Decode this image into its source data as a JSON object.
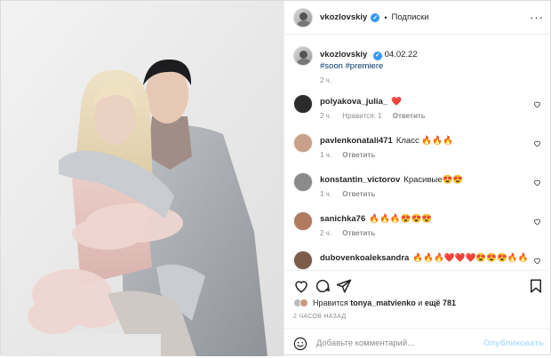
{
  "post": {
    "author": "vkozlovskiy",
    "verified": true,
    "follow_label": "Подписки",
    "dot": "•",
    "more_label": "···"
  },
  "caption": {
    "author": "vkozlovskiy",
    "date": "04.02.22",
    "hashtags": "#soon #premiere",
    "time": "2 ч."
  },
  "comments": [
    {
      "user": "polyakova_julia_",
      "text": "❤️",
      "time": "2 ч.",
      "likes": "Нравится: 1",
      "reply": "Ответить",
      "avatar_color": "#2b2b2b"
    },
    {
      "user": "pavlenkonatali471",
      "text": "Класс 🔥🔥🔥",
      "time": "1 ч.",
      "likes": "",
      "reply": "Ответить",
      "avatar_color": "#c9a089"
    },
    {
      "user": "konstantin_victorov",
      "text": "Красивые😍😍",
      "time": "1 ч.",
      "likes": "",
      "reply": "Ответить",
      "avatar_color": "#8a8a8a"
    },
    {
      "user": "sanichka76",
      "text": "🔥🔥🔥😍😍😍",
      "time": "2 ч.",
      "likes": "",
      "reply": "Ответить",
      "avatar_color": "#b07a60"
    },
    {
      "user": "dubovenkoaleksandra",
      "text": "🔥🔥🔥❤️❤️❤️😍😍😍🔥🔥",
      "time": "",
      "likes": "",
      "reply": "",
      "avatar_color": "#7b5b4a"
    }
  ],
  "likes": {
    "prefix": "Нравится",
    "user": "tonya_matvienko",
    "middle": "и",
    "count": "ещё 781"
  },
  "ago": "2 ЧАСОВ НАЗАД",
  "comment_box": {
    "placeholder": "Добавьте комментарий...",
    "publish_label": "Опубликовать"
  },
  "icons": {
    "like": "heart-icon",
    "comment": "comment-icon",
    "share": "paper-plane-icon",
    "save": "bookmark-icon",
    "emoji": "smiley-icon"
  },
  "colors": {
    "link": "#00376b",
    "verified": "#3897f0",
    "muted": "#8e8e8e",
    "publish_disabled": "#b2dffc"
  }
}
